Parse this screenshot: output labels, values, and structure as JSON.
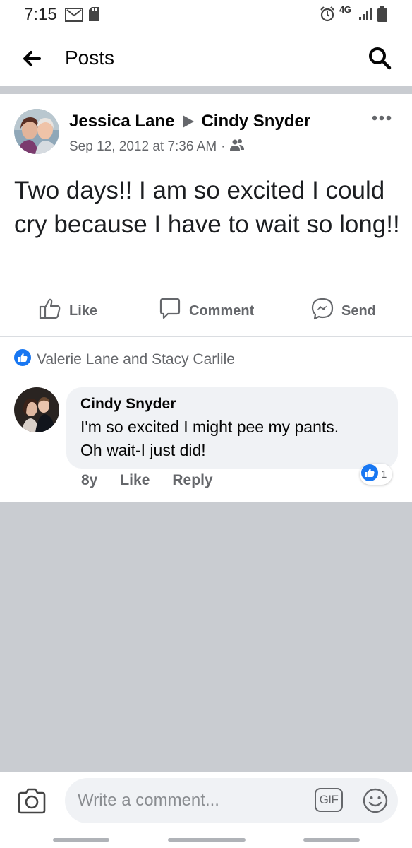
{
  "status_bar": {
    "time": "7:15",
    "network": "4G",
    "icons": [
      "gmail-icon",
      "sd-card-icon",
      "alarm-icon",
      "signal-icon",
      "battery-icon"
    ]
  },
  "nav": {
    "title": "Posts",
    "icons": [
      "back-arrow-icon",
      "search-icon"
    ]
  },
  "post": {
    "author": "Jessica Lane",
    "recipient": "Cindy Snyder",
    "timestamp": "Sep 12, 2012 at 7:36 AM",
    "audience_icon": "friends-icon",
    "body": "Two days!! I am so excited I could cry because I have to wait so long!!",
    "actions": {
      "like": "Like",
      "comment": "Comment",
      "send": "Send"
    },
    "reactions_text": "Valerie Lane and Stacy Carlile"
  },
  "comment": {
    "author": "Cindy Snyder",
    "text_line1": "I'm so excited I might pee my pants.",
    "text_line2": "Oh wait-I just did!",
    "age": "8y",
    "like_label": "Like",
    "reply_label": "Reply",
    "reaction_count": "1"
  },
  "composer": {
    "placeholder": "Write a comment...",
    "gif_label": "GIF"
  },
  "colors": {
    "facebook_blue": "#1877f2",
    "secondary_text": "#65676b",
    "divider_gray": "#c9ccd1",
    "bubble_gray": "#f0f2f5"
  }
}
